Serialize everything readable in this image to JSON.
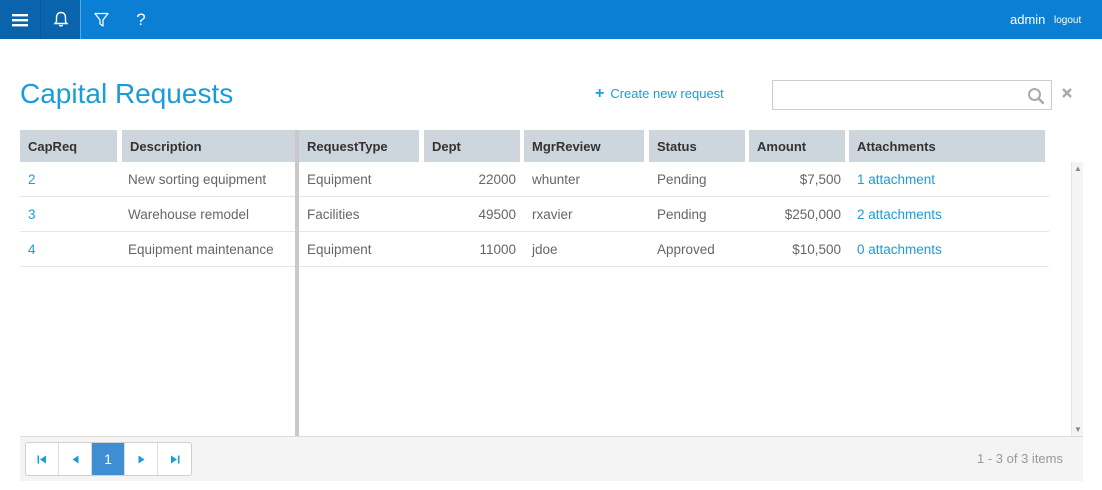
{
  "topbar": {
    "user": "admin",
    "logout_label": "logout",
    "help_label": "?"
  },
  "page": {
    "title": "Capital Requests",
    "create_label": "Create new request",
    "search_value": ""
  },
  "grid": {
    "columns": [
      "CapReq",
      "Description",
      "RequestType",
      "Dept",
      "MgrReview",
      "Status",
      "Amount",
      "Attachments"
    ],
    "rows": [
      {
        "capreq": "2",
        "description": "New sorting equipment",
        "request_type": "Equipment",
        "dept": "22000",
        "mgr_review": "whunter",
        "status": "Pending",
        "amount": "$7,500",
        "attachments": "1 attachment"
      },
      {
        "capreq": "3",
        "description": "Warehouse remodel",
        "request_type": "Facilities",
        "dept": "49500",
        "mgr_review": "rxavier",
        "status": "Pending",
        "amount": "$250,000",
        "attachments": "2 attachments"
      },
      {
        "capreq": "4",
        "description": "Equipment maintenance",
        "request_type": "Equipment",
        "dept": "11000",
        "mgr_review": "jdoe",
        "status": "Approved",
        "amount": "$10,500",
        "attachments": "0 attachments"
      }
    ]
  },
  "pager": {
    "current_page": "1",
    "info": "1 - 3 of 3 items"
  },
  "colors": {
    "topbar": "#0a7fd4",
    "accent": "#1a9cd8",
    "header_bg": "#cdd6dd"
  }
}
